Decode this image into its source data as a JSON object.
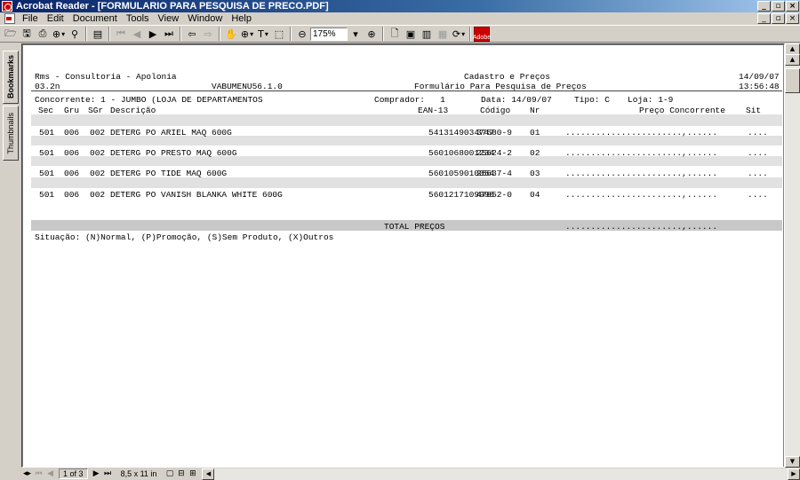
{
  "window": {
    "title": "Acrobat Reader - [FORMULARIO PARA PESQUISA DE PRECO.PDF]",
    "controls": [
      "_",
      "▫",
      "×"
    ]
  },
  "menu": [
    "File",
    "Edit",
    "Document",
    "Tools",
    "View",
    "Window",
    "Help"
  ],
  "toolbar": {
    "zoom_value": "175%",
    "acrobat_label": "Adobe"
  },
  "side_tabs": {
    "bookmarks": "Bookmarks",
    "thumbnails": "Thumbnails"
  },
  "report": {
    "company": "Rms - Consultoria - Apolonia",
    "version": "03.2n",
    "program": "VABUMENU56.1.0",
    "section": "Cadastro e Preços",
    "form_title": "Formulário Para Pesquisa de Preços",
    "date": "14/09/07",
    "time": "13:56:48",
    "info": {
      "competitor": "Concorrente: 1 - JUMBO (LOJA DE DEPARTAMENTOS",
      "buyer": "Comprador:   1",
      "date": "Data: 14/09/07",
      "type": "Tipo: C",
      "store": "Loja: 1-9"
    },
    "columns": {
      "sec": "Sec",
      "gru": "Gru",
      "sgr": "SGr",
      "description": "Descrição",
      "ean": "EAN-13",
      "code": "Código",
      "nr": "Nr",
      "price": "Preço Concorrente",
      "sit": "Sit"
    },
    "rows": [
      {
        "sec": "501",
        "gru": "006",
        "sgr": "002",
        "description": "DETERG PO ARIEL MAQ 600G",
        "ean": "5413149034747",
        "code": "37680-9",
        "nr": "01",
        "price": ".......................,......",
        "sit": "...."
      },
      {
        "sec": "501",
        "gru": "006",
        "sgr": "002",
        "description": "DETERG PO PRESTO MAQ 600G",
        "ean": "5601068001234",
        "code": "25624-2",
        "nr": "02",
        "price": ".......................,......",
        "sit": "...."
      },
      {
        "sec": "501",
        "gru": "006",
        "sgr": "002",
        "description": "DETERG PO TIDE MAQ 600G",
        "ean": "5601059010054",
        "code": "25637-4",
        "nr": "03",
        "price": ".......................,......",
        "sit": "...."
      },
      {
        "sec": "501",
        "gru": "006",
        "sgr": "002",
        "description": "DETERG PO VANISH BLANKA WHITE 600G",
        "ean": "5601217109996",
        "code": "47052-0",
        "nr": "04",
        "price": ".......................,......",
        "sit": "...."
      }
    ],
    "total_label": "TOTAL PREÇOS",
    "total_price": ".......................,......",
    "legend": "Situação: (N)Normal, (P)Promoção, (S)Sem Produto, (X)Outros"
  },
  "status": {
    "page": "1 of 3",
    "page_size": "8,5 x 11 in"
  }
}
